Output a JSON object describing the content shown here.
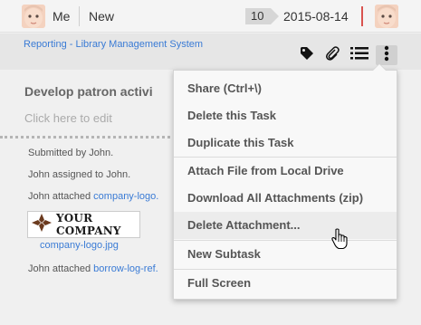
{
  "header": {
    "me_label": "Me",
    "status_label": "New",
    "count_badge": "10",
    "date": "2015-08-14",
    "accent_color": "#d9534f"
  },
  "breadcrumb": {
    "text": "Reporting - Library Management System"
  },
  "toolbar": {
    "icons": [
      "tag-icon",
      "paperclip-icon",
      "list-icon",
      "more-vertical-icon"
    ]
  },
  "task": {
    "title": "Develop patron activi",
    "edit_hint": "Click here to edit"
  },
  "activity": {
    "submitted": "Submitted by John.",
    "assigned": "John assigned to John.",
    "attached_prefix": "John attached ",
    "attached_link_1": "company-logo.",
    "attached_link_2": "borrow-log-ref.",
    "logo_text": "YOUR COMPANY",
    "logo_file": "company-logo.jpg"
  },
  "menu": {
    "items": [
      "Share (Ctrl+\\)",
      "Delete this Task",
      "Duplicate this Task",
      "Attach File from Local Drive",
      "Download All Attachments (zip)",
      "Delete Attachment...",
      "New Subtask",
      "Full Screen"
    ]
  },
  "colors": {
    "link": "#3a7bd5",
    "menu_bg": "#f8f8f8"
  }
}
